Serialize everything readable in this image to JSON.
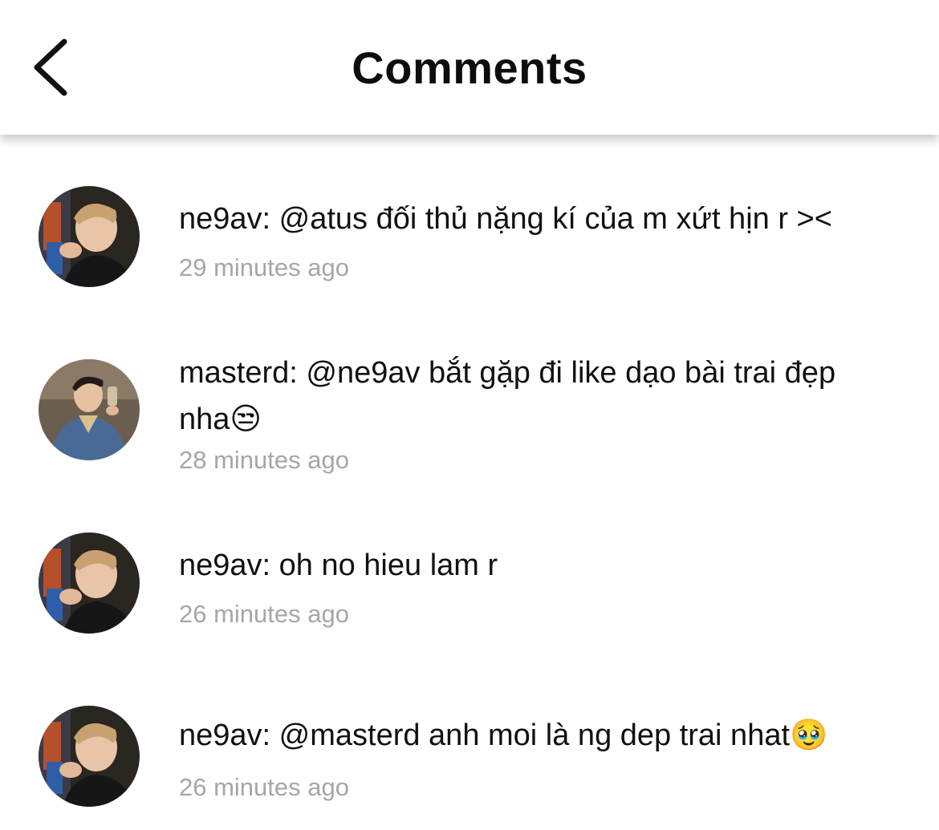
{
  "header": {
    "title": "Comments",
    "back_icon": "chevron-left-icon"
  },
  "comments": [
    {
      "username": "ne9av",
      "text": "ne9av: @atus đối thủ nặng kí của m xứt hịn r ><",
      "time": "29 minutes ago",
      "avatar": "avatar-photo-ne9av"
    },
    {
      "username": "masterd",
      "text": "masterd: @ne9av bắt gặp đi like dạo bài trai đẹp nha😒",
      "time": "28 minutes ago",
      "avatar": "avatar-photo-masterd"
    },
    {
      "username": "ne9av",
      "text": "ne9av: oh no hieu lam r",
      "time": "26 minutes ago",
      "avatar": "avatar-photo-ne9av"
    },
    {
      "username": "ne9av",
      "text": "ne9av: @masterd anh moi là ng dep trai nhat🥹",
      "time": "26 minutes ago",
      "avatar": "avatar-photo-ne9av"
    }
  ]
}
